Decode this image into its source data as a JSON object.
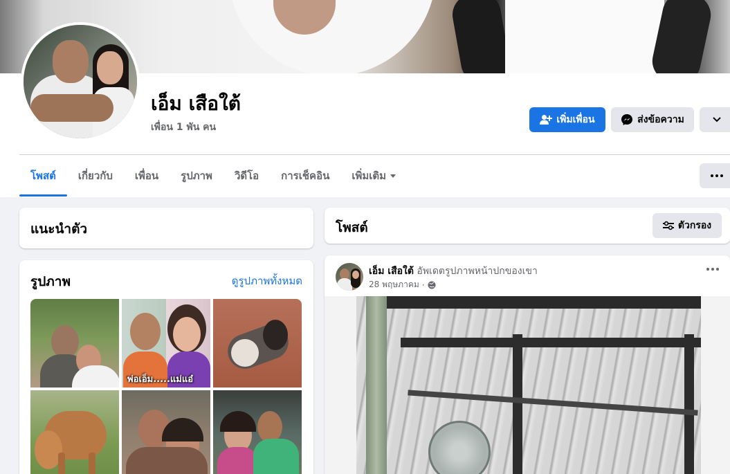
{
  "profile": {
    "name": "เอ็ม เสือใต้",
    "friends_count": "เพื่อน 1 พัน คน"
  },
  "actions": {
    "add_friend": "เพิ่มเพื่อน",
    "message": "ส่งข้อความ"
  },
  "tabs": [
    {
      "label": "โพสต์",
      "active": true
    },
    {
      "label": "เกี่ยวกับ"
    },
    {
      "label": "เพื่อน"
    },
    {
      "label": "รูปภาพ"
    },
    {
      "label": "วิดีโอ"
    },
    {
      "label": "การเช็คอิน"
    },
    {
      "label": "เพิ่มเติม"
    }
  ],
  "intro": {
    "title": "แนะนำตัว"
  },
  "photos": {
    "title": "รูปภาพ",
    "see_all": "ดูรูปภาพทั้งหมด",
    "photo2_caption": "พ่อเอ็ม.....แม่แอ๋"
  },
  "posts": {
    "title": "โพสต์",
    "filter_label": "ตัวกรอง"
  },
  "post": {
    "author": "เอ็ม เสือใต้",
    "action": "อัพเดตรูปภาพหน้าปกของเขา",
    "date": "28 พฤษภาคม",
    "separator": "·"
  },
  "colors": {
    "accent": "#1b74e4",
    "page_bg": "#f0f2f5",
    "secondary_button": "#e4e6eb",
    "muted_text": "#65676b"
  },
  "icons": {
    "add_friend": "person-plus-icon",
    "message": "messenger-icon",
    "more": "chevron-down-icon",
    "filter": "sliders-icon",
    "privacy": "globe-icon",
    "overflow": "three-dots-icon"
  }
}
